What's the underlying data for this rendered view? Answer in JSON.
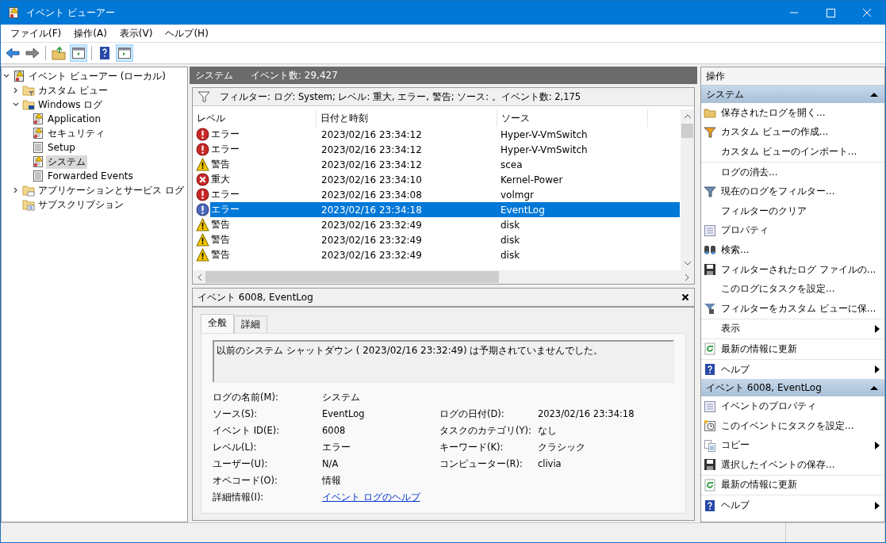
{
  "window": {
    "title": "イベント ビューアー"
  },
  "menu": [
    "ファイル(F)",
    "操作(A)",
    "表示(V)",
    "ヘルプ(H)"
  ],
  "toolbar": [
    {
      "kind": "back",
      "selected": false
    },
    {
      "kind": "forward",
      "selected": false
    },
    {
      "kind": "sep"
    },
    {
      "kind": "up",
      "selected": false
    },
    {
      "kind": "pane",
      "selected": true
    },
    {
      "kind": "sep"
    },
    {
      "kind": "help",
      "selected": false
    },
    {
      "kind": "pane2",
      "selected": true
    }
  ],
  "tree": [
    {
      "label": "イベント ビューアー (ローカル)",
      "kind": "root",
      "expanded": true,
      "selected": false,
      "children": [
        {
          "label": "カスタム ビュー",
          "kind": "filterfolder",
          "expanded": false,
          "selected": false
        },
        {
          "label": "Windows ログ",
          "kind": "pcfolder",
          "expanded": true,
          "selected": false,
          "children": [
            {
              "label": "Application",
              "kind": "log",
              "selected": false
            },
            {
              "label": "セキュリティ",
              "kind": "log",
              "selected": false
            },
            {
              "label": "Setup",
              "kind": "plainlog",
              "selected": false
            },
            {
              "label": "システム",
              "kind": "log",
              "selected": true
            },
            {
              "label": "Forwarded Events",
              "kind": "plainlog",
              "selected": false
            }
          ]
        },
        {
          "label": "アプリケーションとサービス ログ",
          "kind": "folder",
          "expanded": false,
          "selected": false
        },
        {
          "label": "サブスクリプション",
          "kind": "subfolder",
          "selected": false
        }
      ]
    }
  ],
  "center": {
    "title": "システム",
    "count": "イベント数: 29,427",
    "filter": "フィルター: ログ: System; レベル: 重大, エラー, 警告; ソース: 。イベント数: 2,175",
    "columns": [
      "レベル",
      "日付と時刻",
      "ソース"
    ],
    "rows": [
      {
        "kind": "error",
        "level": "エラー",
        "date": "2023/02/16 23:34:12",
        "source": "Hyper-V-VmSwitch",
        "selected": false
      },
      {
        "kind": "error",
        "level": "エラー",
        "date": "2023/02/16 23:34:12",
        "source": "Hyper-V-VmSwitch",
        "selected": false
      },
      {
        "kind": "warning",
        "level": "警告",
        "date": "2023/02/16 23:34:12",
        "source": "scea",
        "selected": false
      },
      {
        "kind": "critical",
        "level": "重大",
        "date": "2023/02/16 23:34:10",
        "source": "Kernel-Power",
        "selected": false
      },
      {
        "kind": "error",
        "level": "エラー",
        "date": "2023/02/16 23:34:08",
        "source": "volmgr",
        "selected": false
      },
      {
        "kind": "error",
        "level": "エラー",
        "date": "2023/02/16 23:34:18",
        "source": "EventLog",
        "selected": true
      },
      {
        "kind": "warning",
        "level": "警告",
        "date": "2023/02/16 23:32:49",
        "source": "disk",
        "selected": false
      },
      {
        "kind": "warning",
        "level": "警告",
        "date": "2023/02/16 23:32:49",
        "source": "disk",
        "selected": false
      },
      {
        "kind": "warning",
        "level": "警告",
        "date": "2023/02/16 23:32:49",
        "source": "disk",
        "selected": false
      }
    ]
  },
  "detail": {
    "title": "イベント 6008, EventLog",
    "tabs": [
      {
        "label": "全般",
        "selected": true
      },
      {
        "label": "詳細",
        "selected": false
      }
    ],
    "message": "以前のシステム シャットダウン ( 2023/02/16 23:32:49) は予期されていませんでした。",
    "fields": [
      {
        "label": "ログの名前(M):",
        "value": "システム"
      },
      {
        "label": "ソース(S):",
        "value": "EventLog",
        "label2": "ログの日付(D):",
        "value2": "2023/02/16 23:34:18"
      },
      {
        "label": "イベント ID(E):",
        "value": "6008",
        "label2": "タスクのカテゴリ(Y):",
        "value2": "なし"
      },
      {
        "label": "レベル(L):",
        "value": "エラー",
        "label2": "キーワード(K):",
        "value2": "クラシック"
      },
      {
        "label": "ユーザー(U):",
        "value": "N/A",
        "label2": "コンピューター(R):",
        "value2": "clivia"
      },
      {
        "label": "オペコード(O):",
        "value": "情報"
      },
      {
        "label": "詳細情報(I):",
        "value": "イベント ログのヘルプ",
        "kind": "link"
      }
    ]
  },
  "actions": {
    "title": "操作",
    "sections": [
      {
        "title": "システム",
        "expanded": true,
        "items": [
          {
            "label": "保存されたログを開く...",
            "submenu": false,
            "divider": false
          },
          {
            "label": "カスタム ビューの作成...",
            "submenu": false,
            "divider": false
          },
          {
            "label": "カスタム ビューのインポート...",
            "submenu": false,
            "divider": true
          },
          {
            "label": "ログの消去...",
            "submenu": false,
            "divider": false
          },
          {
            "label": "現在のログをフィルター...",
            "submenu": false,
            "divider": false
          },
          {
            "label": "フィルターのクリア",
            "submenu": false,
            "divider": false
          },
          {
            "label": "プロパティ",
            "submenu": false,
            "divider": false
          },
          {
            "label": "検索...",
            "submenu": false,
            "divider": false
          },
          {
            "label": "フィルターされたログ ファイルの...",
            "submenu": false,
            "divider": false
          },
          {
            "label": "このログにタスクを設定...",
            "submenu": false,
            "divider": false
          },
          {
            "label": "フィルターをカスタム ビューに保...",
            "submenu": false,
            "divider": true
          },
          {
            "label": "表示",
            "submenu": true,
            "divider": true
          },
          {
            "label": "最新の情報に更新",
            "submenu": false,
            "divider": true
          },
          {
            "label": "ヘルプ",
            "submenu": true,
            "divider": false
          }
        ]
      },
      {
        "title": "イベント 6008, EventLog",
        "expanded": true,
        "items": [
          {
            "label": "イベントのプロパティ",
            "submenu": false,
            "divider": false
          },
          {
            "label": "このイベントにタスクを設定...",
            "submenu": false,
            "divider": false
          },
          {
            "label": "コピー",
            "submenu": true,
            "divider": false
          },
          {
            "label": "選択したイベントの保存...",
            "submenu": false,
            "divider": true
          },
          {
            "label": "最新の情報に更新",
            "submenu": false,
            "divider": true
          },
          {
            "label": "ヘルプ",
            "submenu": true,
            "divider": false
          }
        ]
      }
    ]
  }
}
